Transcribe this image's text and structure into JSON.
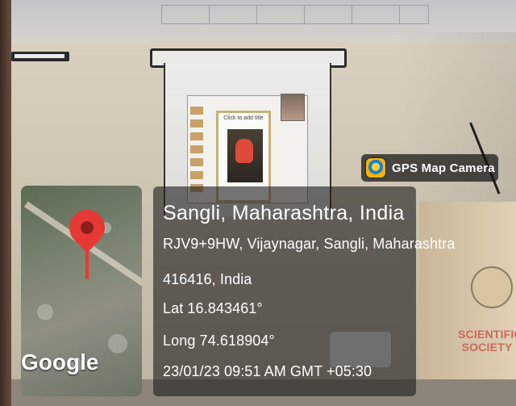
{
  "photo": {
    "slide_title": "Click to add title",
    "podium_text": "SCIENTIFIC SOCIETY"
  },
  "gps": {
    "app_name": "GPS Map Camera",
    "place": "Sangli, Maharashtra, India",
    "address_line1": "RJV9+9HW, Vijaynagar, Sangli, Maharashtra",
    "address_line2": "416416, India",
    "lat": "Lat 16.843461°",
    "long": "Long 74.618904°",
    "datetime": "23/01/23 09:51 AM GMT +05:30",
    "map_label": "Google"
  },
  "icons": {
    "app": "gps-map-camera-icon",
    "pin": "map-pin-icon"
  },
  "colors": {
    "pin": "#e53935",
    "overlay": "rgba(30,30,30,0.62)"
  }
}
